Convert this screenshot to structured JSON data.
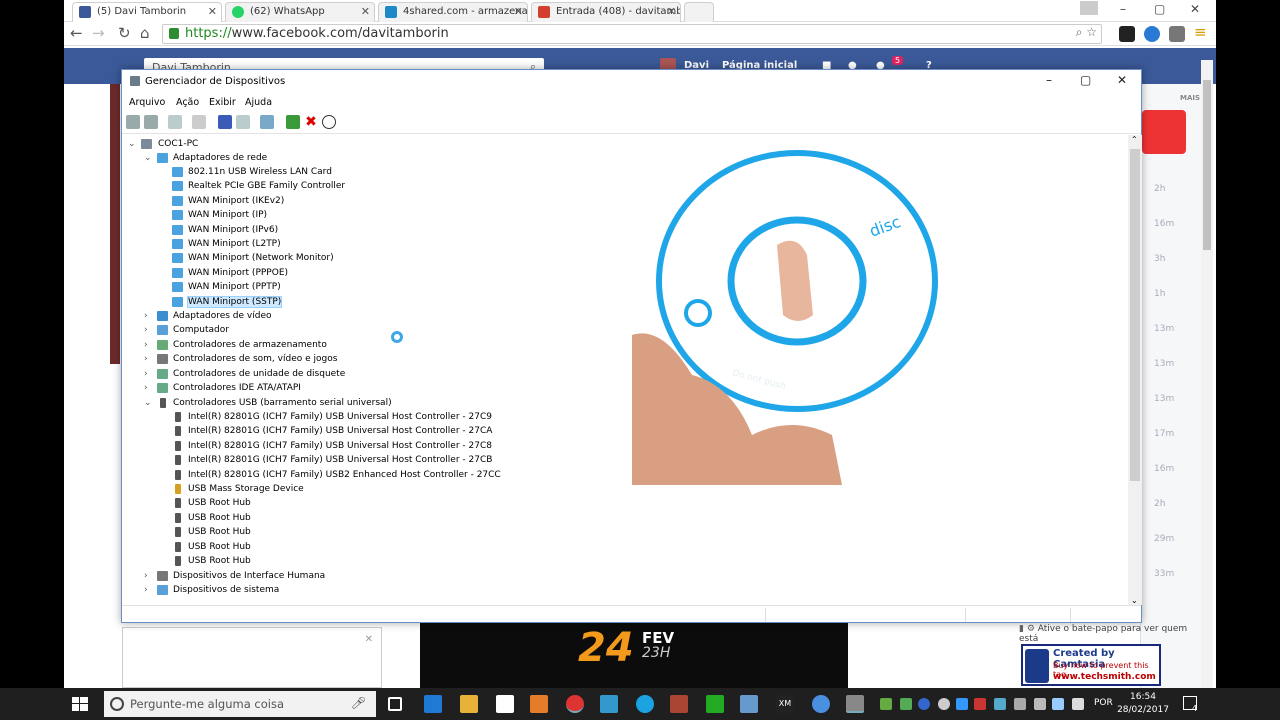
{
  "browser": {
    "tabs": [
      {
        "label": "(5) Davi Tamborin",
        "icon": "facebook-icon",
        "color": "#3b5998"
      },
      {
        "label": "(62) WhatsApp",
        "icon": "whatsapp-icon",
        "color": "#25d366"
      },
      {
        "label": "4shared.com - armazenan",
        "icon": "4shared-icon",
        "color": "#1e88c8"
      },
      {
        "label": "Entrada (408) - davitambo",
        "icon": "gmail-icon",
        "color": "#d23f31"
      }
    ],
    "url_scheme": "https://",
    "url_rest": "www.facebook.com/davitamborin"
  },
  "facebook": {
    "search_value": "Davi Tamborin",
    "user_name": "Davi",
    "home_label": "Página inicial",
    "notif_count": "5",
    "more_label": "MAIS",
    "chat_status": "Ative o bate-papo para ver quem está",
    "times": [
      "2h",
      "16m",
      "3h",
      "1h",
      "13m",
      "13m",
      "13m",
      "17m",
      "16m",
      "2h",
      "29m",
      "33m"
    ]
  },
  "promo": {
    "day": "24",
    "month": "FEV",
    "hour": "23H"
  },
  "camtasia": {
    "line1": "Created by Camtasia",
    "line2": "Buy now to prevent this tag",
    "line3": "www.techsmith.com"
  },
  "device_manager": {
    "title": "Gerenciador de Dispositivos",
    "menu": [
      "Arquivo",
      "Ação",
      "Exibir",
      "Ajuda"
    ],
    "root": "COC1-PC",
    "network_group": "Adaptadores de rede",
    "network_items": [
      "802.11n USB Wireless LAN Card",
      "Realtek PCIe GBE Family Controller",
      "WAN Miniport (IKEv2)",
      "WAN Miniport (IP)",
      "WAN Miniport (IPv6)",
      "WAN Miniport (L2TP)",
      "WAN Miniport (Network Monitor)",
      "WAN Miniport (PPPOE)",
      "WAN Miniport (PPTP)",
      "WAN Miniport (SSTP)"
    ],
    "groups_mid": [
      "Adaptadores de vídeo",
      "Computador",
      "Controladores de armazenamento",
      "Controladores de som, vídeo e jogos",
      "Controladores de unidade de disquete",
      "Controladores IDE ATA/ATAPI"
    ],
    "usb_group": "Controladores USB (barramento serial universal)",
    "usb_items": [
      "Intel(R) 82801G (ICH7 Family) USB Universal Host Controller - 27C9",
      "Intel(R) 82801G (ICH7 Family) USB Universal Host Controller - 27CA",
      "Intel(R) 82801G (ICH7 Family) USB Universal Host Controller - 27C8",
      "Intel(R) 82801G (ICH7 Family) USB Universal Host Controller - 27CB",
      "Intel(R) 82801G (ICH7 Family) USB2 Enhanced Host Controller - 27CC",
      "USB Mass Storage Device",
      "USB Root Hub",
      "USB Root Hub",
      "USB Root Hub",
      "USB Root Hub",
      "USB Root Hub"
    ],
    "groups_end": [
      "Dispositivos de Interface Humana",
      "Dispositivos de sistema"
    ]
  },
  "disc": {
    "brand": "disc",
    "caption": "Do not push"
  },
  "taskbar": {
    "search_placeholder": "Pergunte-me alguma coisa",
    "lang": "POR",
    "time": "16:54",
    "date": "28/02/2017",
    "notif_count": "4"
  }
}
